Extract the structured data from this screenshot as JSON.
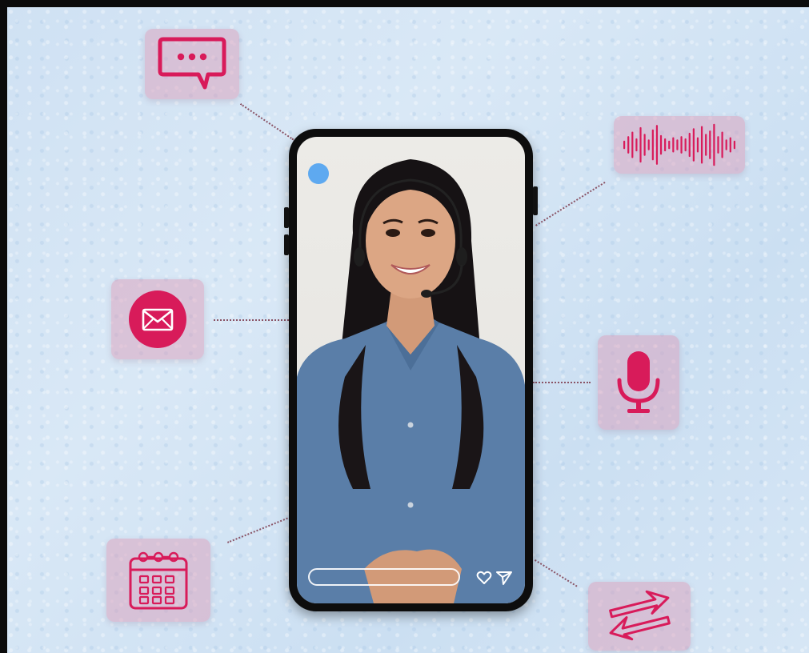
{
  "colors": {
    "accent": "#d81b5a",
    "tile": "#e4a9c2",
    "background": "#d3e4f4",
    "phone": "#0d0d0d",
    "status_dot": "#5ea9f0",
    "shirt": "#5a7ea8"
  },
  "icons": {
    "chat": "chat-bubble-icon",
    "email": "envelope-icon",
    "calendar": "calendar-icon",
    "voice": "sound-wave-icon",
    "microphone": "microphone-icon",
    "transfer": "transfer-arrows-icon",
    "like": "heart-icon",
    "share": "send-icon"
  },
  "phone": {
    "comment_bar": ""
  }
}
